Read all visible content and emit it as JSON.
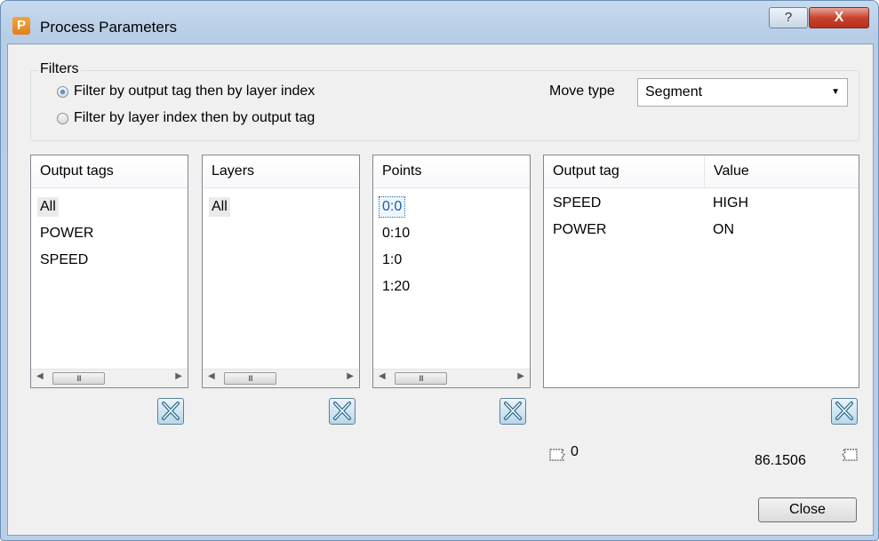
{
  "window": {
    "title": "Process Parameters",
    "icon_letter": "P",
    "help_glyph": "?",
    "close_glyph": "X"
  },
  "filters": {
    "legend": "Filters",
    "option_1": "Filter by output tag then by layer index",
    "option_2": "Filter by layer index then by output tag",
    "selected": 1,
    "move_type_label": "Move type",
    "move_type_value": "Segment"
  },
  "output_tags": {
    "header": "Output tags",
    "items": [
      "All",
      "POWER",
      "SPEED"
    ],
    "selected": "All"
  },
  "layers": {
    "header": "Layers",
    "items": [
      "All"
    ],
    "selected": "All"
  },
  "points": {
    "header": "Points",
    "items": [
      "0:0",
      "0:10",
      "1:0",
      "1:20"
    ],
    "selected": "0:0"
  },
  "values": {
    "col_tag": "Output tag",
    "col_value": "Value",
    "rows": [
      {
        "tag": "SPEED",
        "value": "HIGH"
      },
      {
        "tag": "POWER",
        "value": "ON"
      }
    ]
  },
  "scrollbar": {
    "grip": "III"
  },
  "readouts": {
    "left": "0",
    "right": "86.1506"
  },
  "buttons": {
    "close": "Close"
  },
  "icons": {
    "app": "app-icon",
    "clear": "clear-filter-icon",
    "ruler": "ruler-icon"
  },
  "colors": {
    "accent": "#1e64b4",
    "title_bar": "#b9cfe8"
  }
}
